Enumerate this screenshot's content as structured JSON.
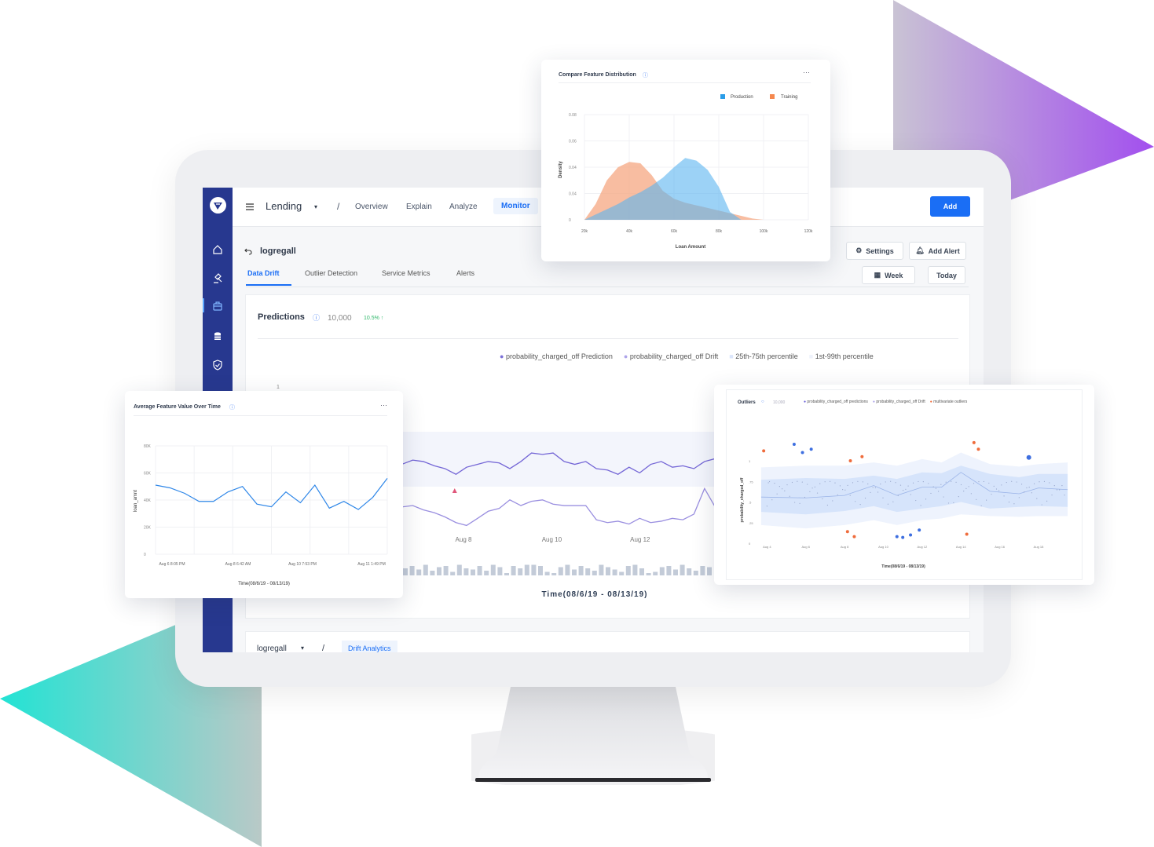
{
  "colors": {
    "accent": "#1a6ef5",
    "sidebar": "#27388f",
    "production": "#5ab4f0",
    "training": "#f5a782",
    "prediction_line": "#7b6fd8",
    "outlier_orange": "#ef6c3c",
    "outlier_blue": "#3e6fe0",
    "positive": "#2fb86a"
  },
  "header": {
    "app": "Lending",
    "separator": "/",
    "tabs": [
      "Overview",
      "Explain",
      "Analyze",
      "Monitor"
    ],
    "active_tab": "Monitor",
    "add_label": "Add",
    "menu_icon": "hamburger-icon"
  },
  "sidebar": {
    "items": [
      "home-icon",
      "gavel-icon",
      "briefcase-icon",
      "database-icon",
      "shield-check-icon"
    ],
    "active": "briefcase-icon"
  },
  "model": {
    "name": "logregall",
    "tabs": [
      "Data Drift",
      "Outlier Detection",
      "Service Metrics",
      "Alerts"
    ],
    "active_tab": "Data Drift",
    "settings_label": "Settings",
    "add_alert_label": "Add Alert",
    "week_label": "Week",
    "today_label": "Today"
  },
  "predictions": {
    "title": "Predictions",
    "count": "10,000",
    "change": "10.5% ↑"
  },
  "bottom": {
    "model": "logregall",
    "separator": "/",
    "tab": "Drift Analytics"
  },
  "chart_data": [
    {
      "id": "drift",
      "type": "line",
      "xlabel": "Time(08/6/19 - 08/13/19)",
      "y_tick_labels": [
        "1"
      ],
      "x_tick_labels": [
        "Aug 8",
        "Aug 10",
        "Aug 12"
      ],
      "x_tick_days": [
        8,
        10,
        12
      ],
      "legend": [
        "probability_charged_off Prediction",
        "probability_charged_off Drift",
        "25th-75th percentile",
        "1st-99th percentile"
      ],
      "x_days": [
        6.6,
        6.85,
        7.09,
        7.34,
        7.58,
        7.83,
        8.07,
        8.32,
        8.56,
        8.81,
        9.05,
        9.3,
        9.54,
        9.79,
        10.03,
        10.28,
        10.52,
        10.77,
        11.01,
        11.26,
        11.5,
        11.75,
        11.99,
        12.24,
        12.48,
        12.73,
        12.97,
        13.22,
        13.46,
        13.7
      ],
      "series": [
        {
          "name": "probability_charged_off Prediction",
          "values": [
            0.45,
            0.48,
            0.47,
            0.44,
            0.42,
            0.38,
            0.43,
            0.45,
            0.47,
            0.46,
            0.42,
            0.47,
            0.53,
            0.52,
            0.53,
            0.47,
            0.45,
            0.47,
            0.42,
            0.41,
            0.38,
            0.43,
            0.39,
            0.45,
            0.47,
            0.43,
            0.44,
            0.42,
            0.47,
            0.49
          ]
        },
        {
          "name": "probability_charged_off Drift",
          "values": [
            0.15,
            0.16,
            0.13,
            0.11,
            0.08,
            0.04,
            0.02,
            0.07,
            0.12,
            0.14,
            0.2,
            0.16,
            0.19,
            0.2,
            0.17,
            0.16,
            0.16,
            0.16,
            0.06,
            0.04,
            0.05,
            0.03,
            0.07,
            0.04,
            0.05,
            0.07,
            0.06,
            0.1,
            0.28,
            0.15
          ]
        }
      ],
      "alert_day": 7.8,
      "volume": [
        6,
        8,
        5,
        9,
        4,
        7,
        8,
        3,
        9,
        6,
        5,
        8,
        4,
        9,
        7,
        2,
        8,
        6,
        9,
        9,
        8,
        3,
        2,
        7,
        9,
        5,
        8,
        6,
        4,
        9,
        7,
        5,
        3,
        8,
        9,
        6,
        2,
        3,
        7,
        8,
        5,
        9,
        6,
        4,
        8,
        7
      ]
    },
    {
      "id": "density",
      "type": "area",
      "title": "Compare Feature Distribution",
      "xlabel": "Loan Amount",
      "ylabel": "Density",
      "legend": [
        "Production",
        "Training"
      ],
      "legend_position": "top-right",
      "x_tick_labels": [
        "20k",
        "40k",
        "60k",
        "80k",
        "100k",
        "120k"
      ],
      "y_tick_labels": [
        "0",
        "0.04",
        "0.04",
        "0.06",
        "0.08"
      ],
      "xlim": [
        20,
        120
      ],
      "ylim": [
        0,
        0.08
      ],
      "x": [
        20,
        25,
        30,
        35,
        40,
        45,
        50,
        55,
        60,
        65,
        70,
        75,
        80,
        85,
        90,
        95,
        100
      ],
      "series": [
        {
          "name": "Production",
          "values": [
            0,
            0.004,
            0.008,
            0.012,
            0.017,
            0.021,
            0.026,
            0.032,
            0.04,
            0.047,
            0.045,
            0.038,
            0.025,
            0.006,
            0,
            0,
            0
          ]
        },
        {
          "name": "Training",
          "values": [
            0,
            0.012,
            0.03,
            0.04,
            0.044,
            0.043,
            0.034,
            0.022,
            0.016,
            0.013,
            0.011,
            0.009,
            0.007,
            0.005,
            0.003,
            0.001,
            0
          ]
        }
      ]
    },
    {
      "id": "avg",
      "type": "line",
      "title": "Average Feature Value Over Time",
      "xlabel": "Time(08/6/19 - 08/13/19)",
      "ylabel": "loan_amnt",
      "y_tick_labels": [
        "0",
        "20K",
        "40K",
        "60K",
        "80K"
      ],
      "ylim": [
        0,
        80
      ],
      "x_tick_labels": [
        "Aug 6 8:05 PM",
        "Aug 8 6:42 AM",
        "Aug 10 7:53 PM",
        "Aug 11 1:49 PM"
      ],
      "values": [
        51,
        49,
        45,
        39,
        39,
        46,
        50,
        37,
        35,
        46,
        38,
        51,
        34,
        39,
        33,
        42,
        56
      ]
    },
    {
      "id": "outliers",
      "type": "scatter",
      "title": "Outliers",
      "count": "10,000",
      "xlabel": "Time(08/6/19 - 08/13/19)",
      "ylabel": "probability_charged_off",
      "legend": [
        "probability_charged_off predictions",
        "probability_charged_off Drift",
        "multivariate outliers"
      ],
      "y_tick_labels": [
        "0",
        ".25",
        ".5",
        ".75",
        "1"
      ],
      "ylim": [
        0,
        1
      ],
      "x_tick_labels": [
        "Aug 4",
        "Aug 6",
        "Aug 8",
        "Aug 10",
        "Aug 12",
        "Aug 14",
        "Aug 16",
        "Aug 18"
      ],
      "xlim": [
        3.5,
        19.7
      ],
      "median": {
        "x": [
          3.7,
          6,
          8,
          9.5,
          10.7,
          12,
          13,
          14,
          15.5,
          17,
          18,
          19.5
        ],
        "y": [
          0.56,
          0.55,
          0.58,
          0.7,
          0.58,
          0.68,
          0.68,
          0.86,
          0.63,
          0.6,
          0.67,
          0.65
        ]
      },
      "p25": [
        0.38,
        0.35,
        0.39,
        0.45,
        0.38,
        0.42,
        0.45,
        0.5,
        0.42,
        0.44,
        0.45,
        0.44
      ],
      "p75": [
        0.77,
        0.79,
        0.78,
        0.82,
        0.78,
        0.86,
        0.85,
        0.94,
        0.84,
        0.8,
        0.84,
        0.84
      ],
      "p1": [
        0.22,
        0.18,
        0.22,
        0.28,
        0.22,
        0.28,
        0.3,
        0.35,
        0.33,
        0.32,
        0.33,
        0.33
      ],
      "p99": [
        0.92,
        0.94,
        0.94,
        0.98,
        0.94,
        1.02,
        0.98,
        1.1,
        0.96,
        0.93,
        0.96,
        0.98
      ],
      "outliers_orange": [
        [
          3.83,
          1.12
        ],
        [
          8.3,
          1.0
        ],
        [
          8.9,
          1.05
        ],
        [
          8.15,
          0.14
        ],
        [
          8.5,
          0.08
        ],
        [
          14.67,
          1.22
        ],
        [
          14.9,
          1.14
        ],
        [
          14.3,
          0.11
        ]
      ],
      "outliers_blue": [
        [
          5.4,
          1.2
        ],
        [
          5.83,
          1.1
        ],
        [
          6.28,
          1.14
        ],
        [
          10.7,
          0.08
        ],
        [
          11.0,
          0.07
        ],
        [
          11.4,
          0.1
        ],
        [
          11.85,
          0.16
        ],
        [
          17.5,
          1.04
        ]
      ]
    }
  ]
}
